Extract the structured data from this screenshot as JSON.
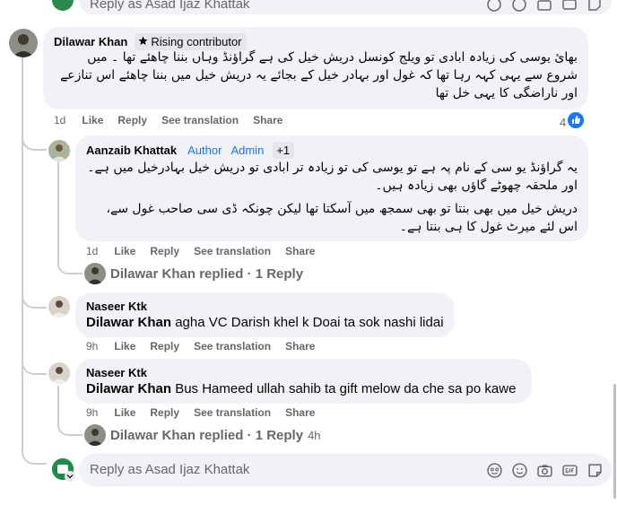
{
  "top_reply": {
    "placeholder": "Reply as Asad Ijaz Khattak"
  },
  "comment1": {
    "author": "Dilawar Khan",
    "badge": "Rising contributor",
    "text": "بهائ یوسی کی زیادہ ابادی تو ویلج کونسل دریش خیل کی ہے گراؤنڈ وہاں بننا چاھئے تھا ۔ میں شروع سے یہی کہہ رہا تھا کہ غول اور بہادر خیل کے بجائے یہ دریش خیل میں بننا چاھئے اس تنازعے اور ناراضگی کا یہی خل تھا",
    "time": "1d",
    "like": "Like",
    "reply": "Reply",
    "translate": "See translation",
    "share": "Share",
    "reaction_count": "4"
  },
  "comment2": {
    "author": "Aanzaib Khattak",
    "role_author": "Author",
    "role_admin": "Admin",
    "role_more": "+1",
    "para1": "یہ گراؤنڈ یو سی کے نام پہ ہے تو یوسی کی تو زیادہ تر ابادی تو دریش خیل بہادرخیل میں ہے۔ اور ملحقہ چھوٹے گاؤں بھی زیادہ ہیں۔",
    "para2": "دریش خیل میں بھی بنتا تو بھی سمجھ میں آسکتا تھا لیکن چونکہ ڈی سی صاحب غول سے، اس لئے میرٹ غول کا ہی بنتا ہے۔",
    "time": "1d",
    "like": "Like",
    "reply": "Reply",
    "translate": "See translation",
    "share": "Share",
    "replied": "Dilawar Khan replied · 1 Reply"
  },
  "comment3": {
    "author": "Naseer Ktk",
    "tag": "Dilawar Khan",
    "text": "agha VC Darish khel k Doai ta sok nashi lidai",
    "time": "9h",
    "like": "Like",
    "reply": "Reply",
    "translate": "See translation",
    "share": "Share"
  },
  "comment4": {
    "author": "Naseer Ktk",
    "tag": "Dilawar Khan",
    "text": "Bus Hameed ullah sahib ta gift melow da che sa po kawe",
    "time": "9h",
    "like": "Like",
    "reply": "Reply",
    "translate": "See translation",
    "share": "Share",
    "replied": "Dilawar Khan replied · 1 Reply",
    "replied_time": "4h"
  },
  "bottom_reply": {
    "placeholder": "Reply as Asad Ijaz Khattak"
  },
  "colors": {
    "bubble": "#f0f2f5",
    "link": "#1b74e4",
    "muted": "#65676b",
    "like_blue": "#1877f2"
  },
  "icons": [
    "sticker-smile-icon",
    "emoji-icon",
    "camera-icon",
    "gif-icon",
    "sticker-icon"
  ]
}
